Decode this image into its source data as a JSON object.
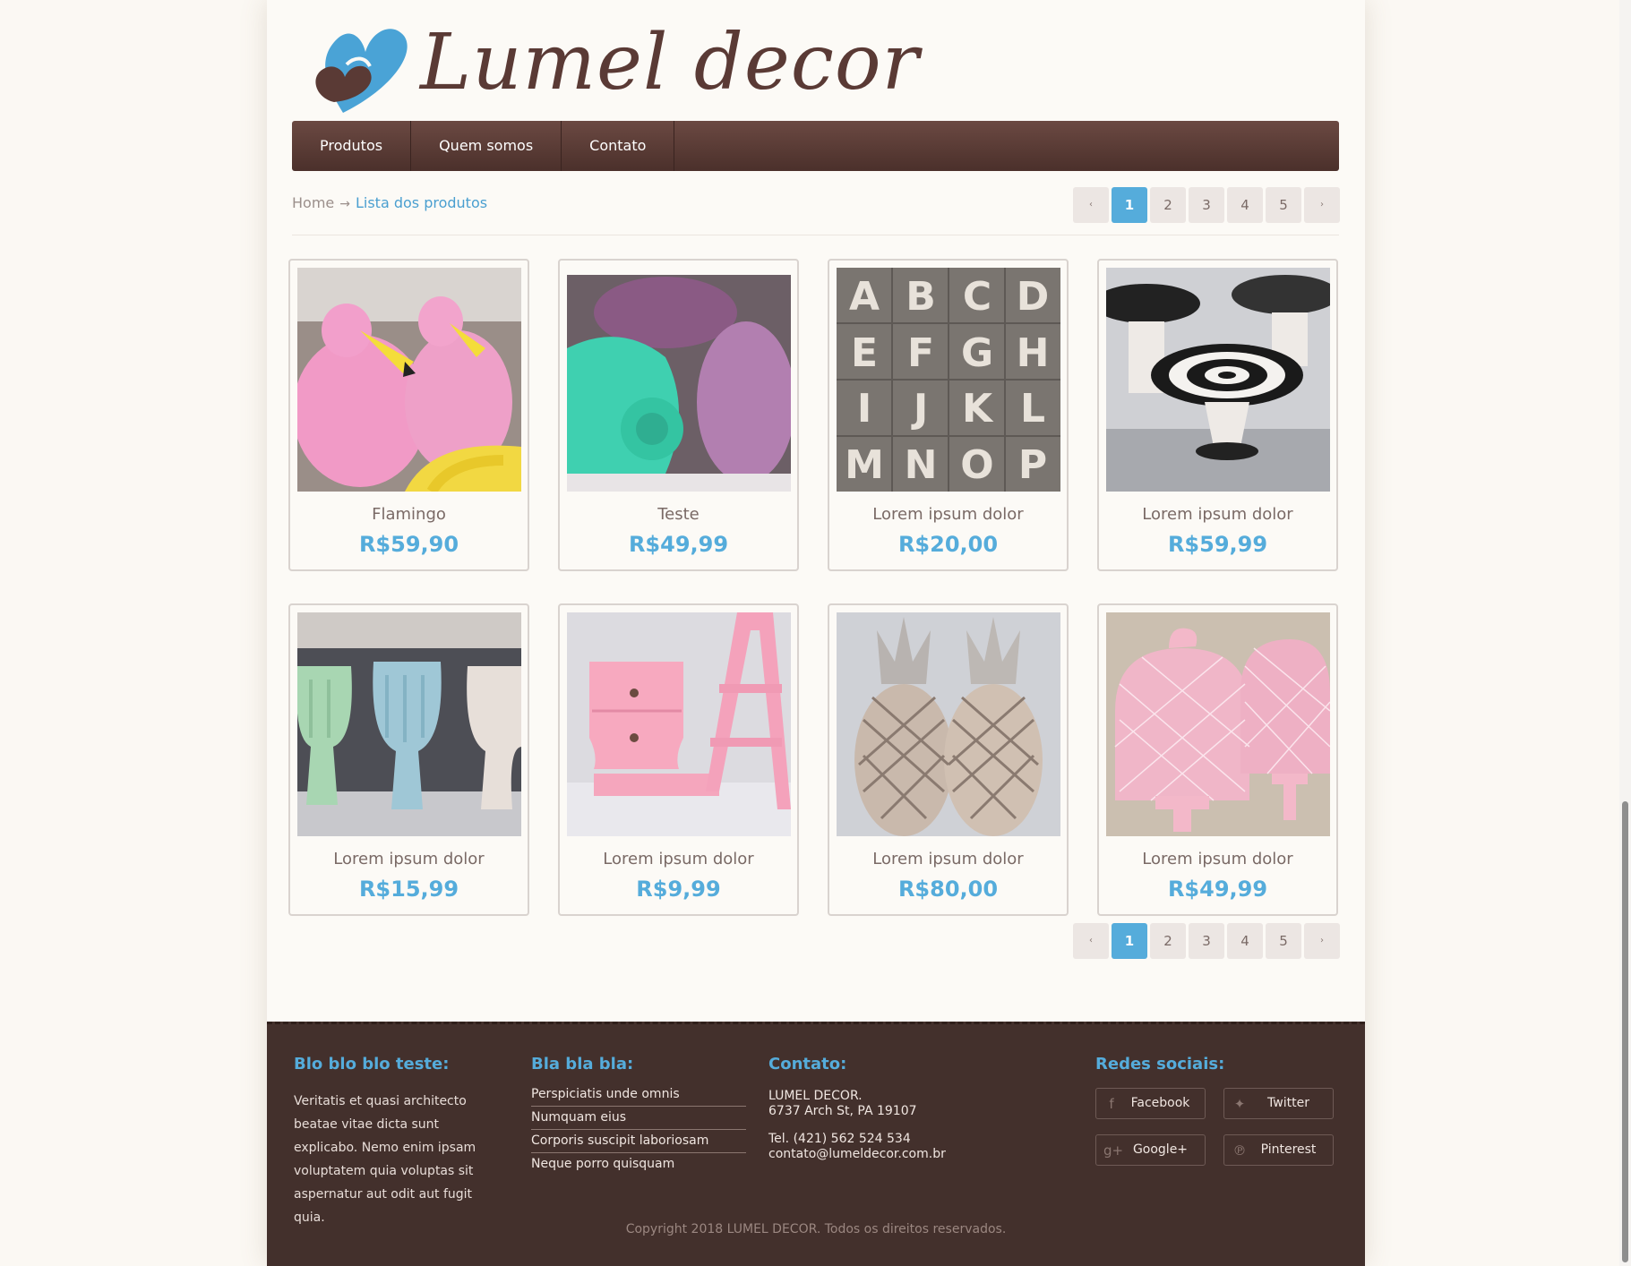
{
  "brand": {
    "name": "Lumel decor",
    "logo_icon": "heart-logo-icon",
    "colors": {
      "blue": "#4aa3d6",
      "brown": "#5a3a35"
    }
  },
  "nav": {
    "items": [
      "Produtos",
      "Quem somos",
      "Contato"
    ]
  },
  "breadcrumb": {
    "home": "Home",
    "separator": "→",
    "current": "Lista dos produtos"
  },
  "pagination": {
    "prev": "‹",
    "next": "›",
    "pages": [
      "1",
      "2",
      "3",
      "4",
      "5"
    ],
    "active": "1"
  },
  "products": [
    {
      "name": "Flamingo",
      "price": "R$59,90",
      "image": "flamingo"
    },
    {
      "name": "Teste",
      "price": "R$49,99",
      "image": "shell-vases"
    },
    {
      "name": "Lorem ipsum dolor",
      "price": "R$20,00",
      "image": "marquee-letters"
    },
    {
      "name": "Lorem ipsum dolor",
      "price": "R$59,99",
      "image": "cake-stands"
    },
    {
      "name": "Lorem ipsum dolor",
      "price": "R$15,99",
      "image": "pastel-vases"
    },
    {
      "name": "Lorem ipsum dolor",
      "price": "R$9,99",
      "image": "pink-furniture"
    },
    {
      "name": "Lorem ipsum dolor",
      "price": "R$80,00",
      "image": "silver-pineapples"
    },
    {
      "name": "Lorem ipsum dolor",
      "price": "R$49,99",
      "image": "pink-cloches"
    }
  ],
  "footer": {
    "col1": {
      "title": "Blo blo blo teste:",
      "text": "Veritatis et quasi architecto beatae vitae dicta sunt explicabo. Nemo enim ipsam voluptatem quia voluptas sit aspernatur aut odit aut fugit quia."
    },
    "col2": {
      "title": "Bla bla bla:",
      "links": [
        "Perspiciatis unde omnis",
        "Numquam eius",
        "Corporis suscipit laboriosam",
        "Neque porro quisquam"
      ]
    },
    "col3": {
      "title": "Contato:",
      "company": "LUMEL DECOR.",
      "address": "6737 Arch St, PA 19107",
      "phone": "Tel. (421) 562 524 534",
      "email": "contato@lumeldecor.com.br"
    },
    "col4": {
      "title": "Redes sociais:",
      "buttons": [
        {
          "label": "Facebook",
          "icon": "facebook-icon"
        },
        {
          "label": "Twitter",
          "icon": "twitter-icon"
        },
        {
          "label": "Google+",
          "icon": "google-plus-icon"
        },
        {
          "label": "Pinterest",
          "icon": "pinterest-icon"
        }
      ]
    },
    "copyright": "Copyright 2018 LUMEL DECOR. Todos os direitos reservados."
  }
}
